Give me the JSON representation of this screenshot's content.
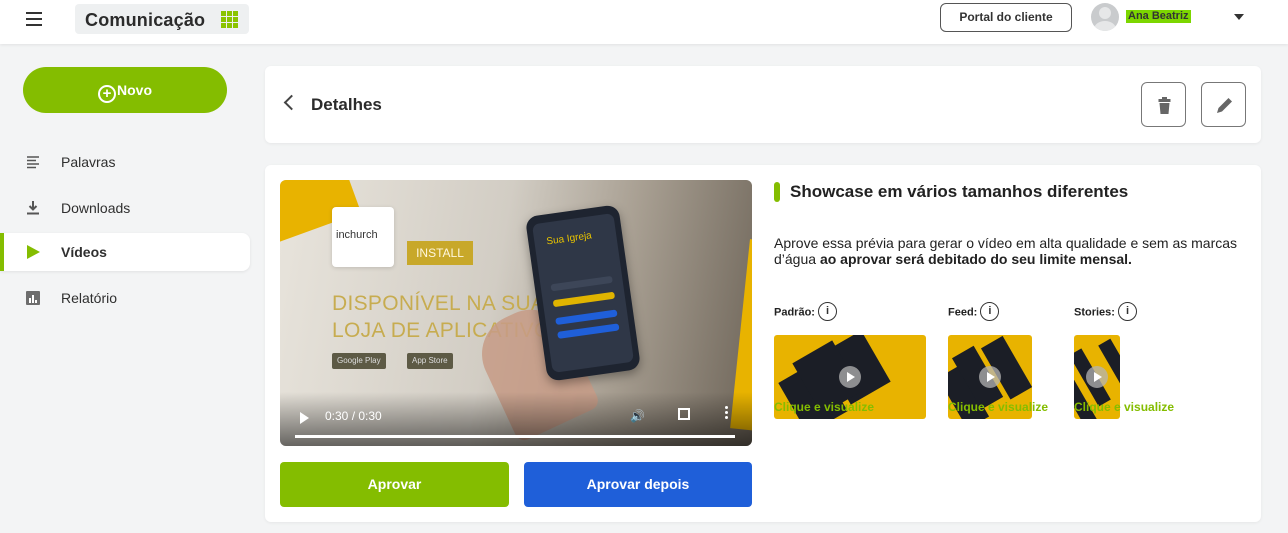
{
  "topbar": {
    "app_title": "Comunicação",
    "portal_button": "Portal do cliente",
    "user_name": "Ana Beatriz"
  },
  "sidebar": {
    "new_button": "Novo",
    "items": [
      {
        "label": "Palavras",
        "icon": "lines-icon",
        "active": false
      },
      {
        "label": "Downloads",
        "icon": "download-icon",
        "active": false
      },
      {
        "label": "Vídeos",
        "icon": "play-icon",
        "active": true
      },
      {
        "label": "Relatório",
        "icon": "bar-chart-icon",
        "active": false
      }
    ]
  },
  "header": {
    "title": "Detalhes"
  },
  "video": {
    "logo_text": "inchurch",
    "install_label": "INSTALL",
    "promo_line_1": "DISPONÍVEL NA SUA",
    "promo_line_2": "LOJA DE APLICATIVOS",
    "google_play": "Google Play",
    "app_store": "App Store",
    "phone_title": "Sua Igreja",
    "time": "0:30 / 0:30",
    "progress": 1.0
  },
  "actions": {
    "approve": "Aprovar",
    "approve_later": "Aprovar depois"
  },
  "info": {
    "title": "Showcase em vários tamanhos diferentes",
    "description_normal": "Aprove essa prévia para gerar o vídeo em alta qualidade e sem as marcas d’água ",
    "description_bold": "ao aprovar será debitado do seu limite mensal."
  },
  "formats": [
    {
      "label": "Padrão:",
      "link": "Clique e visualize"
    },
    {
      "label": "Feed:",
      "link": "Clique e visualize"
    },
    {
      "label": "Stories:",
      "link": "Clique e visualize"
    }
  ],
  "colors": {
    "brand_green": "#84bd00",
    "primary_blue": "#1f5fd9",
    "accent_yellow": "#e8b300"
  }
}
